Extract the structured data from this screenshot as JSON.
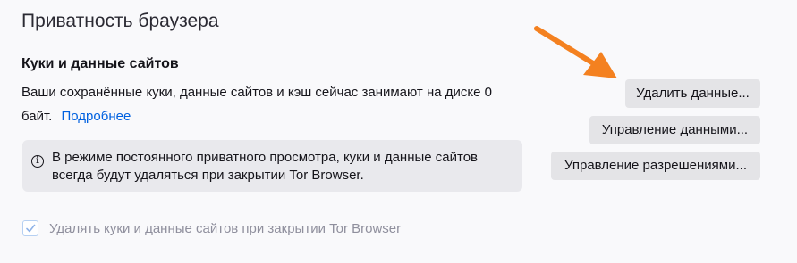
{
  "section": {
    "title": "Приватность браузера"
  },
  "cookies": {
    "title": "Куки и данные сайтов",
    "description": "Ваши сохранённые куки, данные сайтов и кэш сейчас занимают на диске 0 байт.",
    "learn_more": "Подробнее",
    "info_icon": "info-icon",
    "info_text": "В режиме постоянного приватного просмотра, куки и данные сайтов всегда будут удаляться при закрытии Tor Browser.",
    "clear_button": "Удалить данные...",
    "manage_button": "Управление данными...",
    "permissions_button": "Управление разрешениями...",
    "delete_on_close_label": "Удалять куки и данные сайтов при закрытии Tor Browser",
    "delete_on_close_checked": true,
    "delete_on_close_disabled": true
  },
  "annotation": {
    "arrow_icon": "arrow-icon",
    "arrow_color": "#f48120"
  },
  "colors": {
    "background": "#f9f9fb",
    "button": "#e4e4e7",
    "info_box": "#e9e9ed",
    "link": "#0061e0"
  }
}
